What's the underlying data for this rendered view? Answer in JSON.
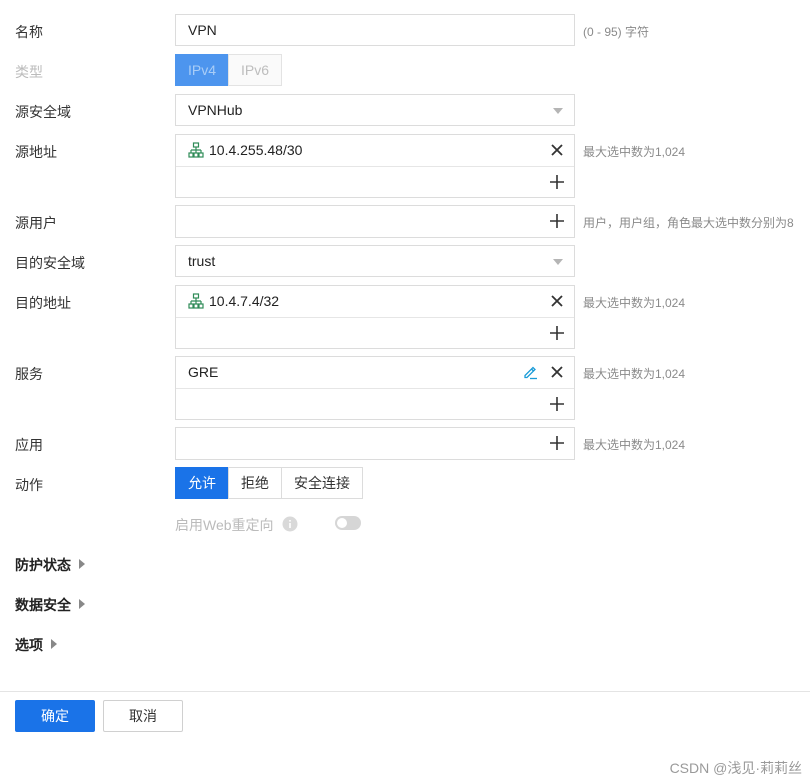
{
  "form": {
    "name": {
      "label": "名称",
      "value": "VPN",
      "hint": "(0 - 95) 字符"
    },
    "type": {
      "label": "类型",
      "options": [
        "IPv4",
        "IPv6"
      ],
      "selected": "IPv4"
    },
    "src_zone": {
      "label": "源安全域",
      "value": "VPNHub"
    },
    "src_addr": {
      "label": "源地址",
      "items": [
        "10.4.255.48/30"
      ],
      "hint": "最大选中数为1,024"
    },
    "src_user": {
      "label": "源用户",
      "hint": "用户，用户组，角色最大选中数分别为8"
    },
    "dst_zone": {
      "label": "目的安全域",
      "value": "trust"
    },
    "dst_addr": {
      "label": "目的地址",
      "items": [
        "10.4.7.4/32"
      ],
      "hint": "最大选中数为1,024"
    },
    "service": {
      "label": "服务",
      "items": [
        "GRE"
      ],
      "hint": "最大选中数为1,024"
    },
    "application": {
      "label": "应用",
      "hint": "最大选中数为1,024"
    },
    "action": {
      "label": "动作",
      "options": [
        "允许",
        "拒绝",
        "安全连接"
      ],
      "selected": "允许"
    },
    "web_redirect": {
      "label": "启用Web重定向",
      "enabled": false
    }
  },
  "sections": {
    "protection": "防护状态",
    "data_security": "数据安全",
    "options": "选项"
  },
  "footer": {
    "confirm": "确定",
    "cancel": "取消"
  },
  "watermark": "CSDN @浅见·莉莉丝",
  "colors": {
    "accent": "#1a73e8",
    "network_icon": "#2e8b57",
    "edit_icon": "#1a9bd7"
  }
}
